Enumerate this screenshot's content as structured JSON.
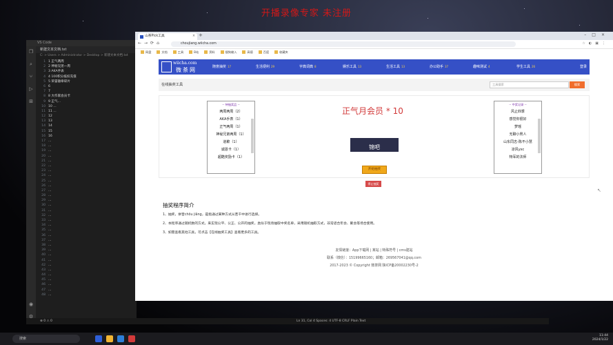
{
  "banner": "开播录像专家 未注册",
  "vscode": {
    "title": "VS Code",
    "tab": "新建文本文档.txt",
    "breadcrumb": "C: > Users > Administrator > Desktop > 新建文本文档.txt",
    "lines": [
      "1  正气两周",
      "2  神秘兄弟一周",
      "3  AKA手表",
      "4  100积分抵扣充值",
      "5  荣誉徽章碎片",
      "6",
      "7",
      "8  大作家会员卡",
      "9  正气...",
      "10 ...",
      "11 ...",
      "12",
      "13",
      "14",
      "15",
      "16",
      "...",
      "...",
      "...",
      "...",
      "...",
      "...",
      "...",
      "...",
      "...",
      "...",
      "...",
      "...",
      "...",
      "...",
      "...",
      "...",
      "...",
      "...",
      "...",
      "...",
      "...",
      "...",
      "...",
      "...",
      "...",
      "...",
      "...",
      "...",
      "...",
      "...",
      "...",
      "..."
    ]
  },
  "statusbar": {
    "left": "⊗ 0 ⚠ 0",
    "right": "Ln 31, Col 4   Spaces: 4   UTF-8   CRLF   Plain Text"
  },
  "taskbar": {
    "search_placeholder": "搜索",
    "time": "11:44",
    "date": "2024/1/22"
  },
  "browser": {
    "tab_title": "山茶Pick工具",
    "url": "choujiang.wiicha.com",
    "bookmarks": [
      "网盘",
      "文档",
      "工具",
      "B站",
      "资料",
      "搜狗输入",
      "高德",
      "百度",
      "收藏夹"
    ]
  },
  "site": {
    "logo_domain": "wiicha.com",
    "logo_text": "微茶网",
    "nav": [
      {
        "label": "随意抽奖",
        "count": "17"
      },
      {
        "label": "生活便利",
        "count": "29"
      },
      {
        "label": "字典词典",
        "count": "8"
      },
      {
        "label": "娱乐工具",
        "count": "13"
      },
      {
        "label": "生活工具",
        "count": "13"
      },
      {
        "label": "办公助手",
        "count": "37"
      },
      {
        "label": "趣味测试",
        "count": "4"
      },
      {
        "label": "学生工具",
        "count": "26"
      }
    ],
    "user": "登录",
    "subbar_label": "在线抽奖工具",
    "search_placeholder": "工具搜索",
    "search_button": "搜索"
  },
  "left_list": {
    "header": "-- 待抽奖品 --",
    "items": [
      "两周两周（2）",
      "AKA手表（1）",
      "正气两周（1）",
      "神秘兄弟两周（1）",
      "道歉（1）",
      "诚恳卡（1）",
      "超酷奖励卡（1）"
    ]
  },
  "right_list": {
    "header": "-- 中奖记录 --",
    "items": [
      "风止四季",
      "感觉你很好",
      "梦瑶",
      "无聊小男人",
      "山东同志-陈不小慧",
      "凉风yxc",
      "特军的法师"
    ]
  },
  "result_title": "正气月会员 * 10",
  "screen_text": "锦吧",
  "draw_button": "开始抽奖",
  "stop_button": "停止抽奖",
  "intro": {
    "title": "抽奖程序简介",
    "lines": [
      "1、抽奖，拼音chōu jiǎng，是指通过某种方式从若干中进行选择。",
      "2、本程序通过随机数的方式，来实现公平、公正、公开的抽奖，类似于现场抽取中奖名单，采用随机抽取方式，非常适合年会、聚会等场合使用。",
      "3、如需查看其他工具，可点击【在线抽奖工具】查看更多的工具。"
    ]
  },
  "footer": {
    "links": "友情链接：App下载网 | 某站 | 特殊符号 | cms建站",
    "contact": "联系（微信）：15199665160；邮箱：269567041@qq.com",
    "copyright": "2017-2023 © Copyright 微茶网 陕ICP备20002230号-2"
  }
}
